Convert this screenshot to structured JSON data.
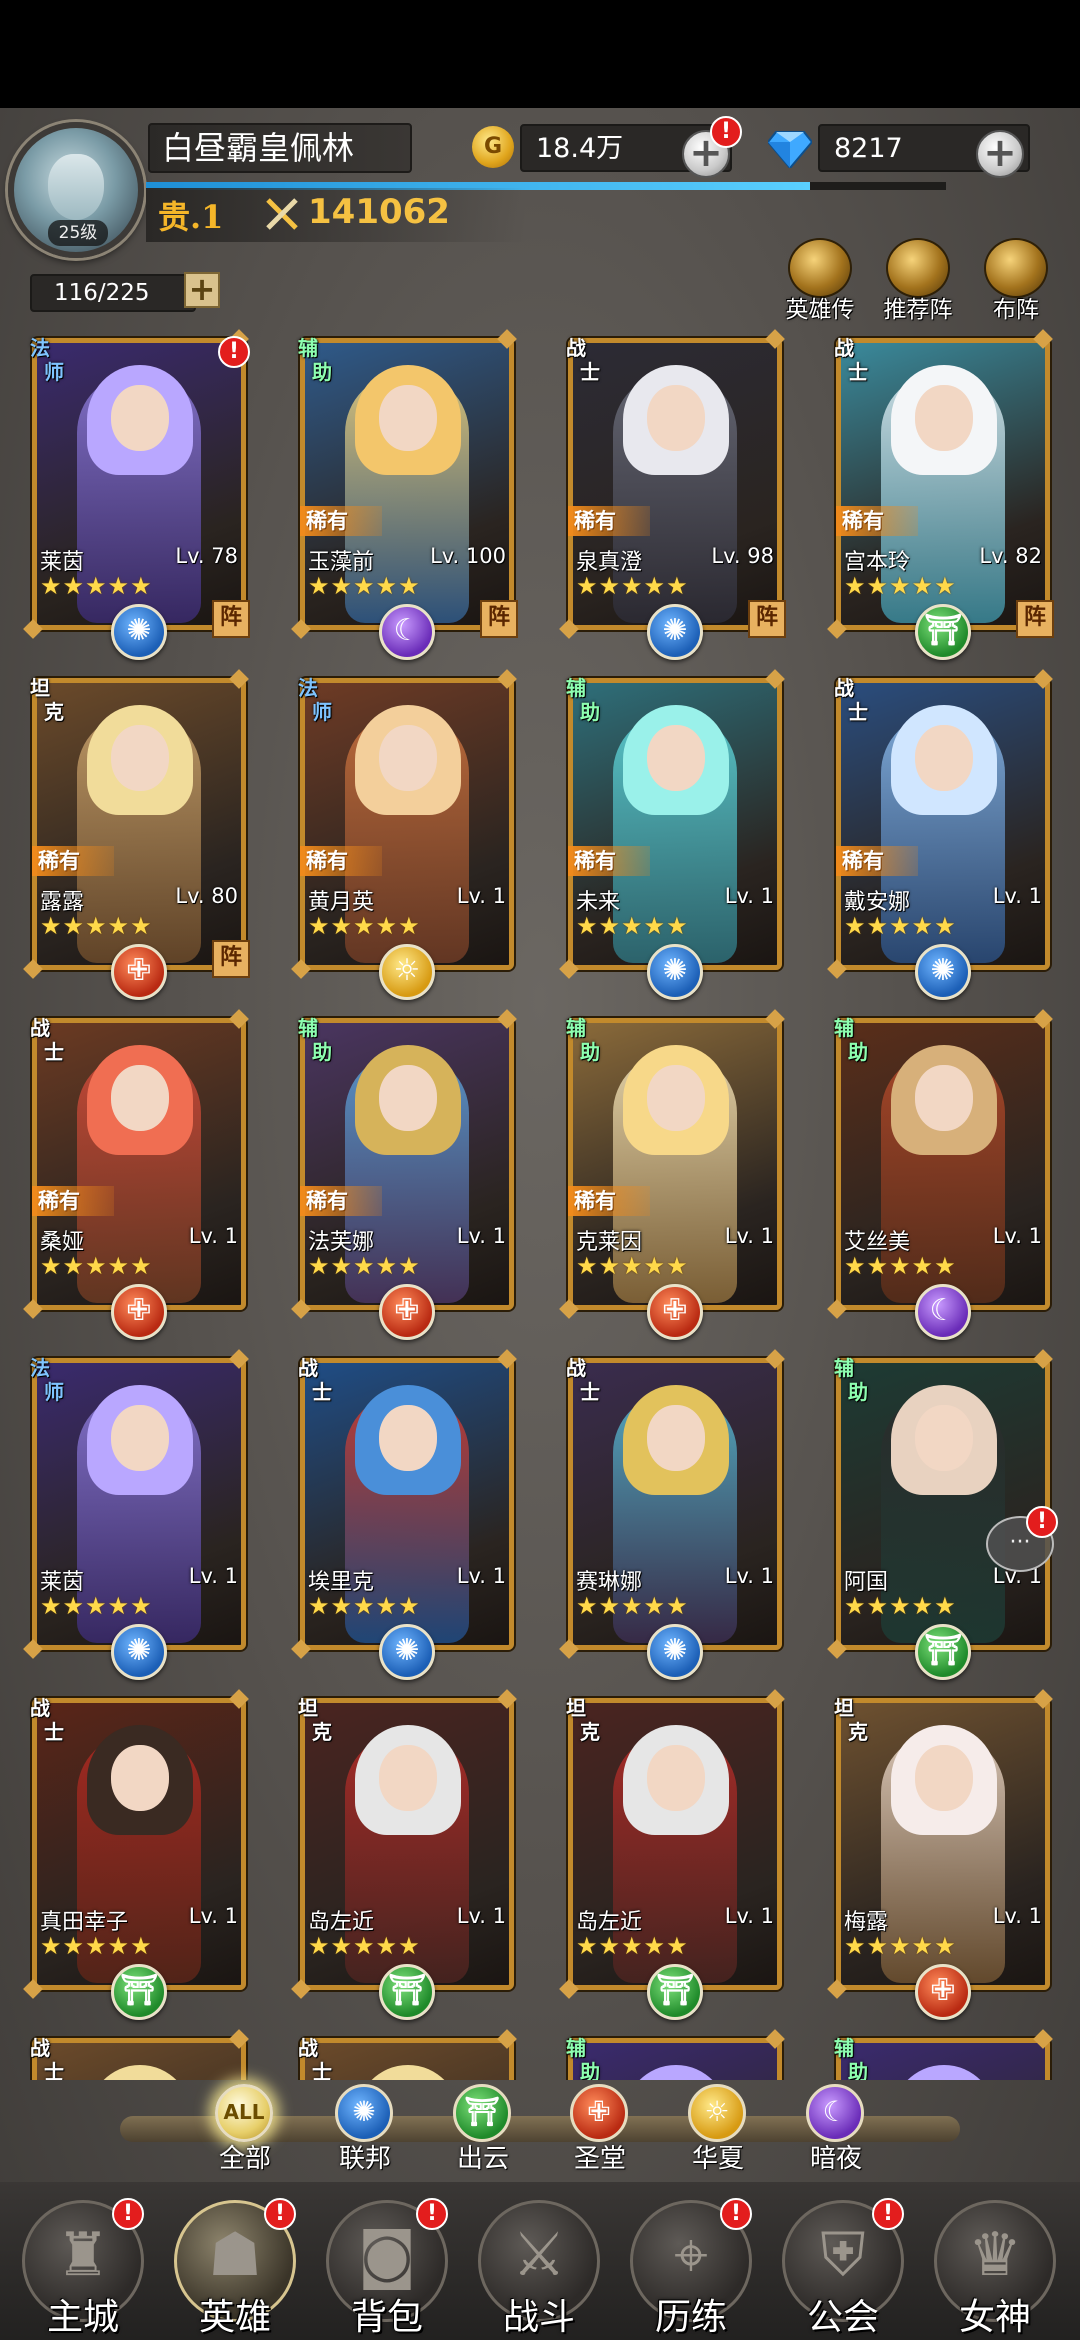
{
  "player": {
    "name": "白昼霸皇佩林",
    "level": "25级",
    "vip": "贵.1",
    "power": "141062",
    "xp_fraction": 0.83
  },
  "resources": {
    "gold": "18.4万",
    "gold_icon": "G",
    "gems": "8217"
  },
  "capacity": "116/225",
  "top_buttons": [
    "英雄传",
    "推荐阵",
    "布阵"
  ],
  "heroes": [
    {
      "role": [
        "法",
        "师"
      ],
      "role_type": "mage",
      "rare": "",
      "name": "莱茵",
      "level": "Lv. 78",
      "faction": "lianbang",
      "formation": "阵",
      "badge": true,
      "palette": [
        "#3a2a6e",
        "#8c7ad6",
        "#b9a7ff"
      ]
    },
    {
      "role": [
        "辅",
        "助"
      ],
      "role_type": "support",
      "rare": "稀有",
      "name": "玉藻前",
      "level": "Lv. 100",
      "faction": "anye",
      "formation": "阵",
      "badge": false,
      "palette": [
        "#2f5a8a",
        "#f0d27a",
        "#f3c66b"
      ]
    },
    {
      "role": [
        "战",
        "士"
      ],
      "role_type": "warrior",
      "rare": "稀有",
      "name": "泉真澄",
      "level": "Lv. 98",
      "faction": "lianbang",
      "formation": "阵",
      "badge": false,
      "palette": [
        "#2c2b35",
        "#6d6f7c",
        "#e8e8ee"
      ]
    },
    {
      "role": [
        "战",
        "士"
      ],
      "role_type": "warrior",
      "rare": "稀有",
      "name": "宫本玲",
      "level": "Lv. 82",
      "faction": "chuyun",
      "formation": "阵",
      "badge": false,
      "palette": [
        "#3a8a9c",
        "#e0ecf1",
        "#f4f6f8"
      ]
    },
    {
      "role": [
        "坦",
        "克"
      ],
      "role_type": "tank",
      "rare": "稀有",
      "name": "露露",
      "level": "Lv. 80",
      "faction": "shengtang",
      "formation": "阵",
      "badge": false,
      "palette": [
        "#6b4a2a",
        "#c9a36d",
        "#f1dc9a"
      ]
    },
    {
      "role": [
        "法",
        "师"
      ],
      "role_type": "mage",
      "rare": "稀有",
      "name": "黄月英",
      "level": "Lv. 1",
      "faction": "huaxia",
      "formation": "",
      "badge": false,
      "palette": [
        "#6e3b25",
        "#c7713e",
        "#f3cf9b"
      ]
    },
    {
      "role": [
        "辅",
        "助"
      ],
      "role_type": "support",
      "rare": "稀有",
      "name": "未来",
      "level": "Lv. 1",
      "faction": "lianbang",
      "formation": "",
      "badge": false,
      "palette": [
        "#2e6f7a",
        "#5fd3d6",
        "#9af1ea"
      ]
    },
    {
      "role": [
        "战",
        "士"
      ],
      "role_type": "warrior",
      "rare": "稀有",
      "name": "戴安娜",
      "level": "Lv. 1",
      "faction": "lianbang",
      "formation": "",
      "badge": false,
      "palette": [
        "#2a4d7e",
        "#8ab7e6",
        "#d0e6ff"
      ]
    },
    {
      "role": [
        "战",
        "士"
      ],
      "role_type": "warrior",
      "rare": "稀有",
      "name": "桑娅",
      "level": "Lv. 1",
      "faction": "shengtang",
      "formation": "",
      "badge": false,
      "palette": [
        "#6b3a22",
        "#d24a3a",
        "#f06e52"
      ]
    },
    {
      "role": [
        "辅",
        "助"
      ],
      "role_type": "support",
      "rare": "稀有",
      "name": "法芙娜",
      "level": "Lv. 1",
      "faction": "shengtang",
      "formation": "",
      "badge": false,
      "palette": [
        "#4a3560",
        "#5ba2d8",
        "#d6b35a"
      ]
    },
    {
      "role": [
        "辅",
        "助"
      ],
      "role_type": "support",
      "rare": "稀有",
      "name": "克莱因",
      "level": "Lv. 1",
      "faction": "shengtang",
      "formation": "",
      "badge": false,
      "palette": [
        "#8a6a3a",
        "#f1e2b8",
        "#f7d889"
      ]
    },
    {
      "role": [
        "辅",
        "助"
      ],
      "role_type": "support",
      "rare": "",
      "name": "艾丝美",
      "level": "Lv. 1",
      "faction": "anye",
      "formation": "",
      "badge": false,
      "palette": [
        "#5a2e1a",
        "#b2492a",
        "#d7b07a"
      ]
    },
    {
      "role": [
        "法",
        "师"
      ],
      "role_type": "mage",
      "rare": "",
      "name": "莱茵",
      "level": "Lv. 1",
      "faction": "lianbang",
      "formation": "",
      "badge": false,
      "palette": [
        "#3a2a6e",
        "#8c7ad6",
        "#b9a7ff"
      ]
    },
    {
      "role": [
        "战",
        "士"
      ],
      "role_type": "warrior",
      "rare": "",
      "name": "埃里克",
      "level": "Lv. 1",
      "faction": "lianbang",
      "formation": "",
      "badge": false,
      "palette": [
        "#1f4d86",
        "#d13a2c",
        "#4a8fd9"
      ]
    },
    {
      "role": [
        "战",
        "士"
      ],
      "role_type": "warrior",
      "rare": "",
      "name": "赛琳娜",
      "level": "Lv. 1",
      "faction": "lianbang",
      "formation": "",
      "badge": false,
      "palette": [
        "#3a2c4e",
        "#56b9d0",
        "#e2c25c"
      ]
    },
    {
      "role": [
        "辅",
        "助"
      ],
      "role_type": "support",
      "rare": "",
      "name": "阿国",
      "level": "Lv. 1",
      "faction": "chuyun",
      "formation": "",
      "badge": false,
      "palette": [
        "#1d3b34",
        "#2b2b2b",
        "#e8d2c0"
      ]
    },
    {
      "role": [
        "战",
        "士"
      ],
      "role_type": "warrior",
      "rare": "",
      "name": "真田幸子",
      "level": "Lv. 1",
      "faction": "chuyun",
      "formation": "",
      "badge": false,
      "palette": [
        "#5a2518",
        "#b02a22",
        "#3a2a22"
      ]
    },
    {
      "role": [
        "坦",
        "克"
      ],
      "role_type": "tank",
      "rare": "",
      "name": "岛左近",
      "level": "Lv. 1",
      "faction": "chuyun",
      "formation": "",
      "badge": false,
      "palette": [
        "#4a2420",
        "#b52c28",
        "#e6e6e6"
      ]
    },
    {
      "role": [
        "坦",
        "克"
      ],
      "role_type": "tank",
      "rare": "",
      "name": "岛左近",
      "level": "Lv. 1",
      "faction": "chuyun",
      "formation": "",
      "badge": false,
      "palette": [
        "#4a2420",
        "#b52c28",
        "#e6e6e6"
      ]
    },
    {
      "role": [
        "坦",
        "克"
      ],
      "role_type": "tank",
      "rare": "",
      "name": "梅露",
      "level": "Lv. 1",
      "faction": "shengtang",
      "formation": "",
      "badge": false,
      "palette": [
        "#6e5130",
        "#e8d6c8",
        "#f6ecea"
      ]
    },
    {
      "role": [
        "战",
        "士"
      ],
      "role_type": "warrior",
      "rare": "",
      "name": "",
      "level": "",
      "faction": "",
      "formation": "",
      "badge": false,
      "palette": [
        "#6b4a2a",
        "#d7a247",
        "#f1dc9a"
      ]
    },
    {
      "role": [
        "战",
        "士"
      ],
      "role_type": "warrior",
      "rare": "",
      "name": "",
      "level": "",
      "faction": "",
      "formation": "",
      "badge": false,
      "palette": [
        "#6b4a2a",
        "#d7a247",
        "#f1dc9a"
      ]
    },
    {
      "role": [
        "辅",
        "助"
      ],
      "role_type": "support",
      "rare": "",
      "name": "",
      "level": "",
      "faction": "",
      "formation": "",
      "badge": false,
      "palette": [
        "#3a2a6e",
        "#8c7ad6",
        "#b9a7ff"
      ]
    },
    {
      "role": [
        "辅",
        "助"
      ],
      "role_type": "support",
      "rare": "",
      "name": "",
      "level": "",
      "faction": "",
      "formation": "",
      "badge": false,
      "palette": [
        "#3a2a6e",
        "#8c7ad6",
        "#b9a7ff"
      ]
    }
  ],
  "stars": "★★★★★",
  "filters": [
    {
      "key": "all",
      "label": "全部",
      "icon_text": "ALL"
    },
    {
      "key": "lianbang",
      "label": "联邦",
      "icon_text": "✺"
    },
    {
      "key": "chuyun",
      "label": "出云",
      "icon_text": "⛩"
    },
    {
      "key": "shengtang",
      "label": "圣堂",
      "icon_text": "✙"
    },
    {
      "key": "huaxia",
      "label": "华夏",
      "icon_text": "☼"
    },
    {
      "key": "anye",
      "label": "暗夜",
      "icon_text": "☾"
    }
  ],
  "active_filter": "all",
  "nav": [
    {
      "label": "主城",
      "icon": "castle-icon",
      "glyph": "♜",
      "badge": true
    },
    {
      "label": "英雄",
      "icon": "hero-icon",
      "glyph": "☗",
      "badge": true
    },
    {
      "label": "背包",
      "icon": "backpack-icon",
      "glyph": "◙",
      "badge": true
    },
    {
      "label": "战斗",
      "icon": "swords-icon",
      "glyph": "⚔",
      "badge": false
    },
    {
      "label": "历练",
      "icon": "map-icon",
      "glyph": "⌖",
      "badge": true
    },
    {
      "label": "公会",
      "icon": "guild-shield-icon",
      "glyph": "⛨",
      "badge": true
    },
    {
      "label": "女神",
      "icon": "goddess-icon",
      "glyph": "♛",
      "badge": false
    }
  ],
  "active_nav": "英雄",
  "chat_badge": true
}
